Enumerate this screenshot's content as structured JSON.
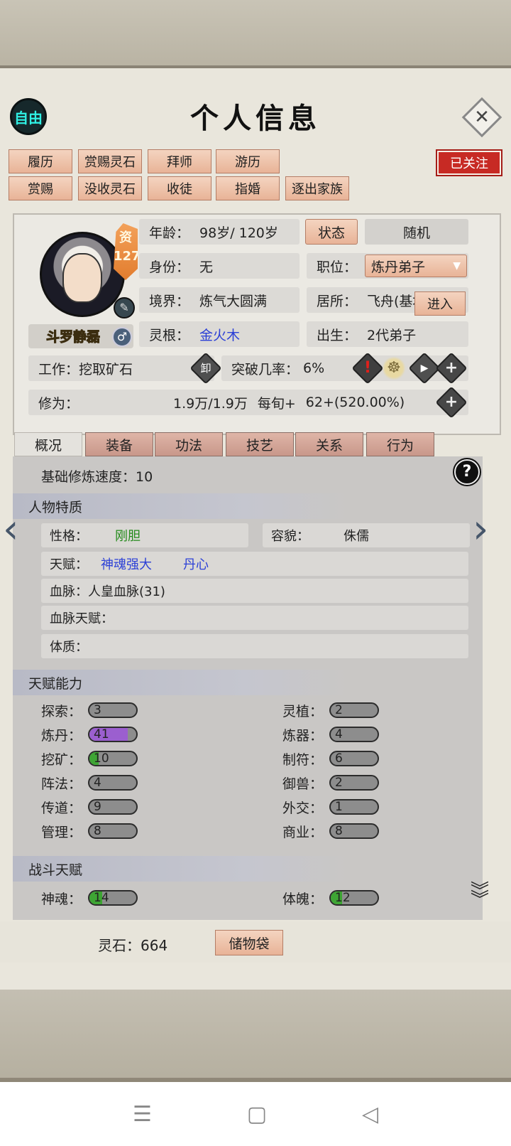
{
  "header": {
    "free_label": "自由",
    "title": "个人信息"
  },
  "actions": {
    "row1": [
      "履历",
      "赏赐灵石",
      "拜师",
      "游历"
    ],
    "row2": [
      "赏赐",
      "没收灵石",
      "收徒",
      "指婚",
      "逐出家族"
    ],
    "follow": "已关注"
  },
  "profile": {
    "aptitude_label": "资",
    "aptitude_value": "127",
    "name": "斗罗静磊",
    "age_label": "年龄：",
    "age_value": "98岁/ 120岁",
    "state_button": "状态",
    "random_button": "随机",
    "identity_label": "身份：",
    "identity_value": "无",
    "position_label": "职位：",
    "position_value": "炼丹弟子",
    "realm_label": "境界：",
    "realm_value": "炼气大圆满",
    "residence_label": "居所：",
    "residence_value": "飞舟(基地",
    "enter_button": "进入",
    "root_label": "灵根：",
    "root_value": "金火木",
    "birth_label": "出生：",
    "birth_value": "2代弟子",
    "work_label": "工作：",
    "work_value": "挖取矿石",
    "unload_icon_text": "卸",
    "breakthrough_label": "突破几率：",
    "breakthrough_value": "6%",
    "cultivation_label": "修为：",
    "cultivation_value": "1.9万/1.9万",
    "per_turn_label": "每旬+",
    "per_turn_value": "62+(520.00%)"
  },
  "tabs": [
    "概况",
    "装备",
    "功法",
    "技艺",
    "关系",
    "行为"
  ],
  "overview": {
    "base_speed": "基础修炼速度：10",
    "traits_title": "人物特质",
    "personality_label": "性格：",
    "personality_value": "刚胆",
    "looks_label": "容貌：",
    "looks_value": "侏儒",
    "talent_label": "天赋：",
    "talent_values": [
      "神魂强大",
      "丹心"
    ],
    "bloodline_label": "血脉：",
    "bloodline_value": "人皇血脉(31)",
    "bloodline_talent_label": "血脉天赋：",
    "constitution_label": "体质：",
    "ability_title": "天赋能力",
    "abilities_left": [
      {
        "label": "探索：",
        "value": "3",
        "fill": 0.0,
        "color": ""
      },
      {
        "label": "炼丹：",
        "value": "41",
        "fill": 0.41,
        "color": "#9b5fcf"
      },
      {
        "label": "挖矿：",
        "value": "10",
        "fill": 0.1,
        "color": "#3ea534"
      },
      {
        "label": "阵法：",
        "value": "4",
        "fill": 0.0,
        "color": ""
      },
      {
        "label": "传道：",
        "value": "9",
        "fill": 0.0,
        "color": ""
      },
      {
        "label": "管理：",
        "value": "8",
        "fill": 0.0,
        "color": ""
      }
    ],
    "abilities_right": [
      {
        "label": "灵植：",
        "value": "2",
        "fill": 0.0,
        "color": ""
      },
      {
        "label": "炼器：",
        "value": "4",
        "fill": 0.0,
        "color": ""
      },
      {
        "label": "制符：",
        "value": "6",
        "fill": 0.0,
        "color": ""
      },
      {
        "label": "御兽：",
        "value": "2",
        "fill": 0.0,
        "color": ""
      },
      {
        "label": "外交：",
        "value": "1",
        "fill": 0.0,
        "color": ""
      },
      {
        "label": "商业：",
        "value": "8",
        "fill": 0.0,
        "color": ""
      }
    ],
    "combat_title": "战斗天赋",
    "combat_left": {
      "label": "神魂：",
      "value": "14",
      "fill": 0.14,
      "color": "#3ea534"
    },
    "combat_right": {
      "label": "体魄：",
      "value": "12",
      "fill": 0.12,
      "color": "#3ea534"
    }
  },
  "footer": {
    "spirit_stones": "灵石：664",
    "bag_button": "储物袋"
  },
  "nav": {
    "menu": "☰",
    "home": "▢",
    "back": "◁"
  }
}
